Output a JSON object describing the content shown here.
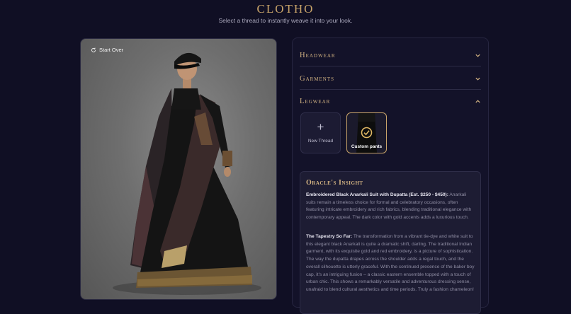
{
  "header": {
    "brand": "CLOTHO",
    "subtitle": "Select a thread to instantly weave it into your look."
  },
  "preview": {
    "start_over_label": "Start Over"
  },
  "accordion": [
    {
      "title": "Headwear",
      "state": "collapsed"
    },
    {
      "title": "Garments",
      "state": "collapsed"
    },
    {
      "title": "Legwear",
      "state": "expanded"
    }
  ],
  "legwear_threads": {
    "new_label": "New Thread",
    "selected_label": "Custom pants"
  },
  "insight": {
    "title": "Oracle's Insight",
    "item_heading": "Embroidered Black Anarkali Suit with Dupatta (Est. $250 - $450):",
    "item_text": "Anarkali suits remain a timeless choice for formal and celebratory occasions, often featuring intricate embroidery and rich fabrics, blending traditional elegance with contemporary appeal. The dark color with gold accents adds a luxurious touch.",
    "tapestry_heading": "The Tapestry So Far:",
    "tapestry_text": "The transformation from a vibrant tie-dye and white suit to this elegant black Anarkali is quite a dramatic shift, darling. The traditional Indian garment, with its exquisite gold and red embroidery, is a picture of sophistication. The way the dupatta drapes across the shoulder adds a regal touch, and the overall silhouette is utterly graceful. With the continued presence of the baker boy cap, it's an intriguing fusion – a classic eastern ensemble topped with a touch of urban chic. This shows a remarkably versatile and adventurous dressing sense, unafraid to blend cultural aesthetics and time periods. Truly a fashion chameleon!"
  },
  "colors": {
    "background": "#100f24",
    "accent_gold": "#c9a46a",
    "panel": "#131229"
  },
  "icons": {
    "start_over": "refresh-icon",
    "accordion_closed": "chevron-down-icon",
    "accordion_open": "chevron-up-icon",
    "new_thread": "plus-icon",
    "selected": "check-circle-icon"
  }
}
